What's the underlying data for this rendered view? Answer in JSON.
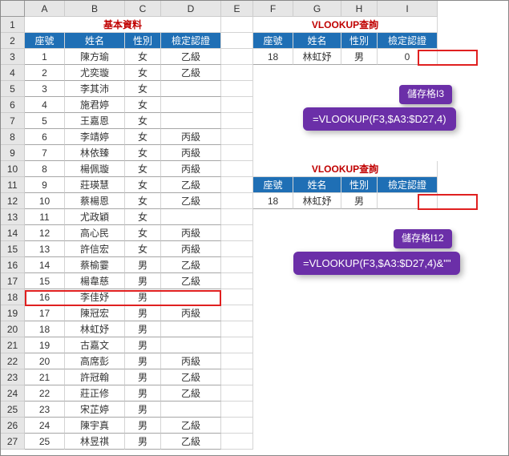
{
  "cols": [
    "A",
    "B",
    "C",
    "D",
    "E",
    "F",
    "G",
    "H",
    "I"
  ],
  "title_main": "基本資料",
  "title_q": "VLOOKUP查詢",
  "headers": [
    "座號",
    "姓名",
    "性別",
    "檢定認證"
  ],
  "rows": [
    {
      "n": "1",
      "name": "陳方瑜",
      "sex": "女",
      "cert": "乙級"
    },
    {
      "n": "2",
      "name": "尤奕璇",
      "sex": "女",
      "cert": "乙級"
    },
    {
      "n": "3",
      "name": "李其沛",
      "sex": "女",
      "cert": ""
    },
    {
      "n": "4",
      "name": "施君婷",
      "sex": "女",
      "cert": ""
    },
    {
      "n": "5",
      "name": "王嘉恩",
      "sex": "女",
      "cert": ""
    },
    {
      "n": "6",
      "name": "李靖婷",
      "sex": "女",
      "cert": "丙級"
    },
    {
      "n": "7",
      "name": "林依臻",
      "sex": "女",
      "cert": "丙級"
    },
    {
      "n": "8",
      "name": "楊佩璇",
      "sex": "女",
      "cert": "丙級"
    },
    {
      "n": "9",
      "name": "莊瑛慧",
      "sex": "女",
      "cert": "乙級"
    },
    {
      "n": "10",
      "name": "蔡楊恩",
      "sex": "女",
      "cert": "乙級"
    },
    {
      "n": "11",
      "name": "尤政穎",
      "sex": "女",
      "cert": ""
    },
    {
      "n": "12",
      "name": "高心民",
      "sex": "女",
      "cert": "丙級"
    },
    {
      "n": "13",
      "name": "許信宏",
      "sex": "女",
      "cert": "丙級"
    },
    {
      "n": "14",
      "name": "蔡榆霎",
      "sex": "男",
      "cert": "乙級"
    },
    {
      "n": "15",
      "name": "楊韋慈",
      "sex": "男",
      "cert": "乙級"
    },
    {
      "n": "16",
      "name": "李佳妤",
      "sex": "男",
      "cert": ""
    },
    {
      "n": "17",
      "name": "陳冠宏",
      "sex": "男",
      "cert": "丙級"
    },
    {
      "n": "18",
      "name": "林虹妤",
      "sex": "男",
      "cert": ""
    },
    {
      "n": "19",
      "name": "古嘉文",
      "sex": "男",
      "cert": ""
    },
    {
      "n": "20",
      "name": "高席彭",
      "sex": "男",
      "cert": "丙級"
    },
    {
      "n": "21",
      "name": "許冠翰",
      "sex": "男",
      "cert": "乙級"
    },
    {
      "n": "22",
      "name": "莊正修",
      "sex": "男",
      "cert": "乙級"
    },
    {
      "n": "23",
      "name": "宋芷婷",
      "sex": "男",
      "cert": ""
    },
    {
      "n": "24",
      "name": "陳宇真",
      "sex": "男",
      "cert": "乙級"
    },
    {
      "n": "25",
      "name": "林昱祺",
      "sex": "男",
      "cert": "乙級"
    }
  ],
  "q1": {
    "n": "18",
    "name": "林虹妤",
    "sex": "男",
    "cert": "0"
  },
  "q2": {
    "n": "18",
    "name": "林虹妤",
    "sex": "男",
    "cert": ""
  },
  "callout1": "儲存格I3",
  "formula1": "=VLOOKUP(F3,$A3:$D27,4)",
  "callout2": "儲存格I12",
  "formula2": "=VLOOKUP(F3,$A3:$D27,4)&\"\""
}
